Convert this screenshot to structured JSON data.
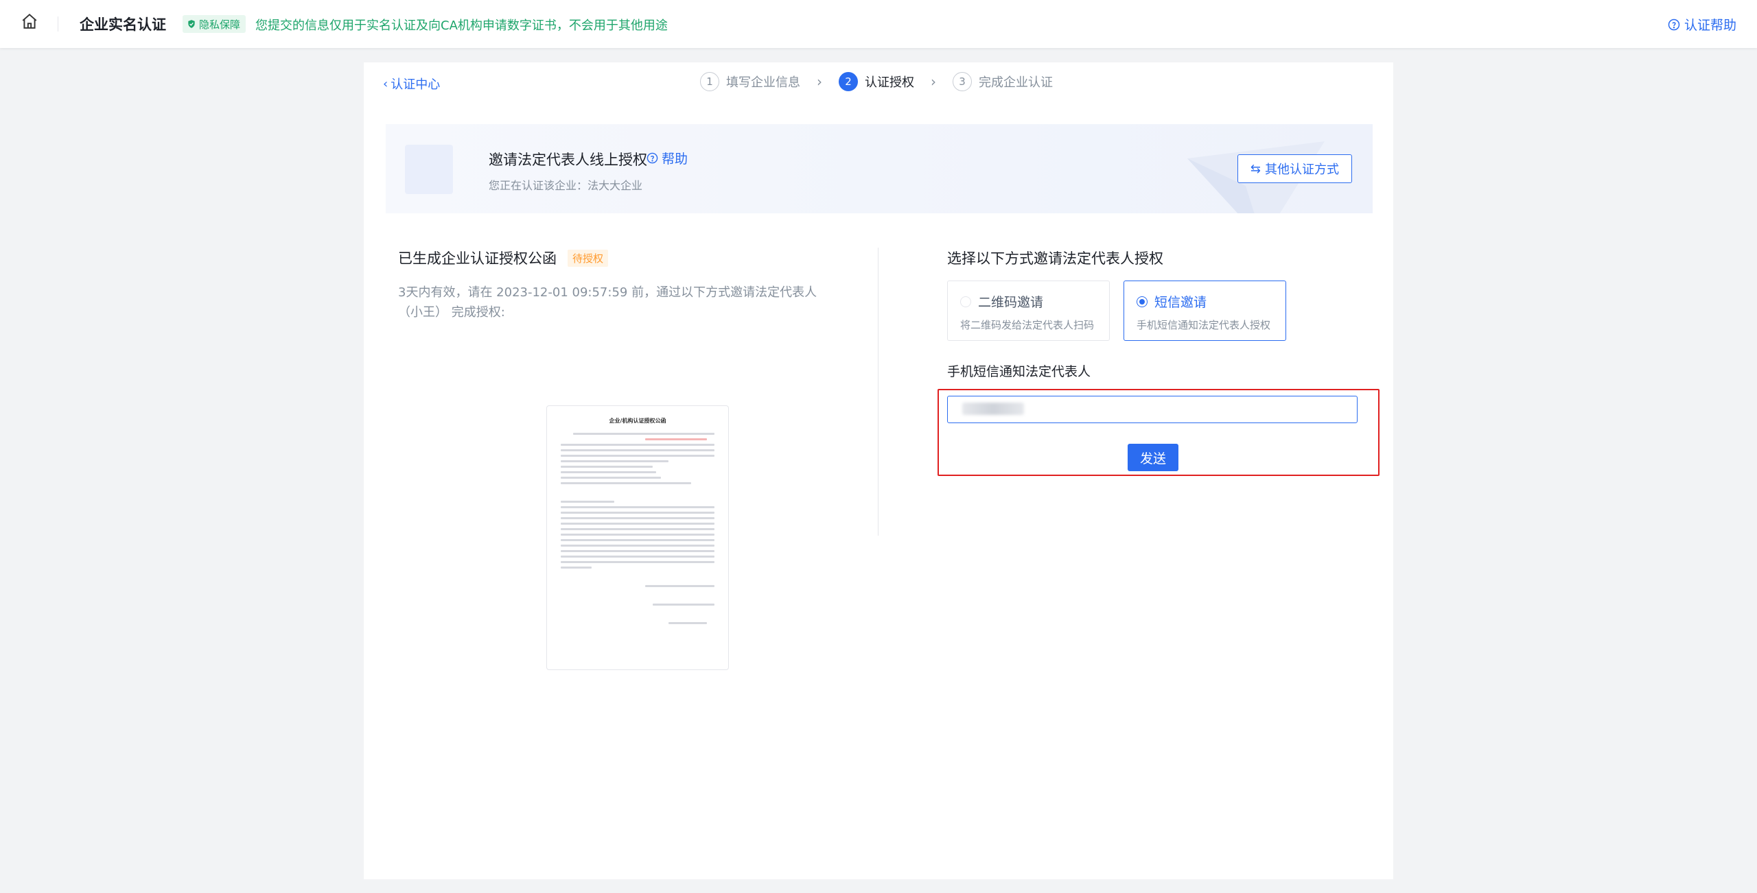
{
  "header": {
    "title": "企业实名认证",
    "privacy_badge": "隐私保障",
    "privacy_text": "您提交的信息仅用于实名认证及向CA机构申请数字证书，不会用于其他用途",
    "help_link": "认证帮助"
  },
  "nav": {
    "back_label": "认证中心",
    "steps": [
      {
        "num": "1",
        "label": "填写企业信息"
      },
      {
        "num": "2",
        "label": "认证授权"
      },
      {
        "num": "3",
        "label": "完成企业认证"
      }
    ]
  },
  "banner": {
    "title": "邀请法定代表人线上授权",
    "help": "帮助",
    "subtitle": "您正在认证该企业：法大大企业",
    "other_method": "其他认证方式"
  },
  "left": {
    "title": "已生成企业认证授权公函",
    "status": "待授权",
    "description": "3天内有效，请在 2023-12-01 09:57:59 前，通过以下方式邀请法定代表人（小王） 完成授权:",
    "doc_title": "企业/机构认证授权公函"
  },
  "right": {
    "title": "选择以下方式邀请法定代表人授权",
    "options": [
      {
        "label": "二维码邀请",
        "sub": "将二维码发给法定代表人扫码"
      },
      {
        "label": "短信邀请",
        "sub": "手机短信通知法定代表人授权"
      }
    ],
    "sms_label": "手机短信通知法定代表人",
    "send_button": "发送"
  },
  "colors": {
    "primary": "#2b6cf0",
    "success": "#1ea56b",
    "warning": "#ff9a2e",
    "highlight": "#e02020"
  }
}
